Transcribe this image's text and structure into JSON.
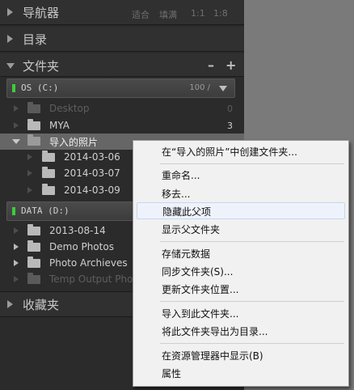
{
  "panels": {
    "navigator": {
      "title": "导航器",
      "options": [
        "适合",
        "填满",
        "1:1",
        "1:8"
      ]
    },
    "catalog": {
      "title": "目录"
    },
    "folders": {
      "title": "文件夹",
      "minus": "–",
      "plus": "+"
    },
    "collections": {
      "title": "收藏夹"
    }
  },
  "volumes": [
    {
      "name": "OS (C:)",
      "usage": "100 /"
    },
    {
      "name": "DATA (D:)"
    }
  ],
  "folders": [
    {
      "label": "Desktop",
      "count": "0"
    },
    {
      "label": "MYA",
      "count": "3"
    },
    {
      "label": "导入的照片"
    },
    {
      "label": "2014-03-06"
    },
    {
      "label": "2014-03-07"
    },
    {
      "label": "2014-03-09"
    },
    {
      "label": "2013-08-14"
    },
    {
      "label": "Demo Photos"
    },
    {
      "label": "Photo Archieves"
    },
    {
      "label": "Temp Output Photo"
    }
  ],
  "context_menu": {
    "items": [
      {
        "label": "在“导入的照片”中创建文件夹..."
      },
      {
        "label": "重命名..."
      },
      {
        "label": "移去..."
      },
      {
        "label": "隐藏此父项"
      },
      {
        "label": "显示父文件夹"
      },
      {
        "label": "存储元数据"
      },
      {
        "label": "同步文件夹(S)..."
      },
      {
        "label": "更新文件夹位置..."
      },
      {
        "label": "导入到此文件夹..."
      },
      {
        "label": "将此文件夹导出为目录..."
      },
      {
        "label": "在资源管理器中显示(B)"
      },
      {
        "label": "属性"
      }
    ]
  }
}
